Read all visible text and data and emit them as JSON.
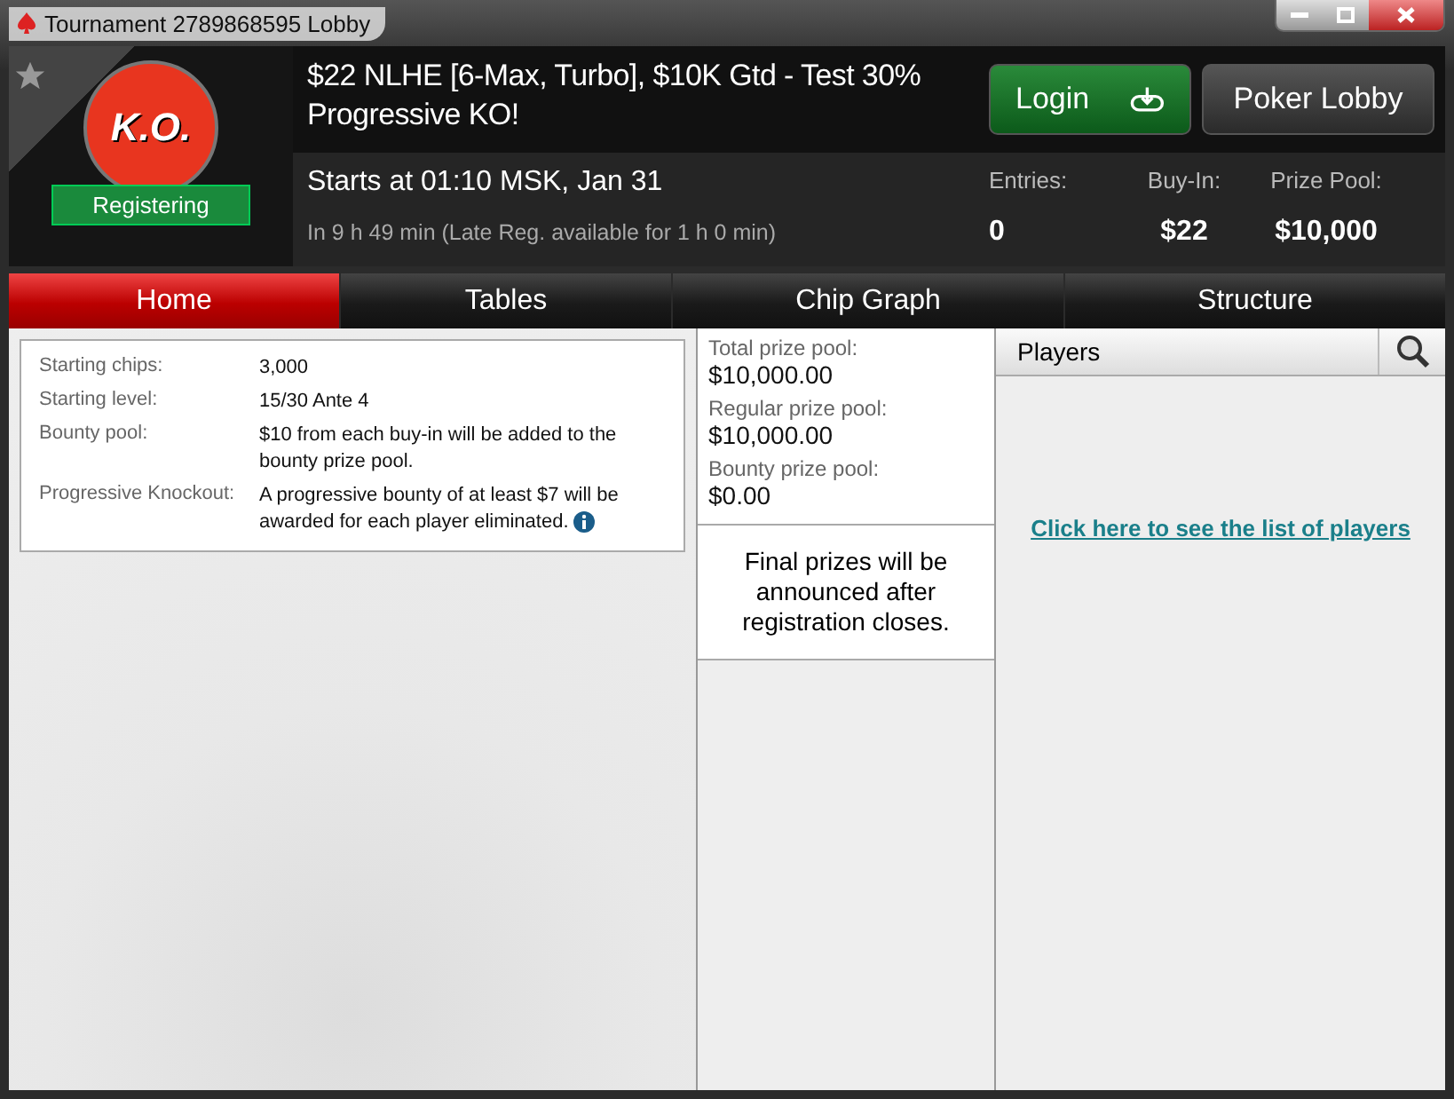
{
  "window": {
    "title": "Tournament 2789868595 Lobby"
  },
  "header": {
    "favorite": false,
    "badge_text": "K.O.",
    "status": "Registering",
    "title": "$22 NLHE [6-Max, Turbo], $10K Gtd - Test 30% Progressive KO!",
    "starts": "Starts at 01:10 MSK, Jan 31",
    "countdown": "In 9 h 49 min (Late Reg. available for 1 h 0 min)",
    "buttons": [
      {
        "label": "Login",
        "kind": "primary"
      },
      {
        "label": "Poker Lobby",
        "kind": "secondary"
      }
    ],
    "stats": [
      {
        "label": "Entries:",
        "value": "0"
      },
      {
        "label": "Buy-In:",
        "value": "$22"
      },
      {
        "label": "Prize Pool:",
        "value": "$10,000"
      }
    ]
  },
  "tabs": [
    {
      "label": "Home",
      "selected": true
    },
    {
      "label": "Tables",
      "selected": false
    },
    {
      "label": "Chip Graph",
      "selected": false
    },
    {
      "label": "Structure",
      "selected": false
    }
  ],
  "info": [
    {
      "label": "Starting chips:",
      "value": "3,000"
    },
    {
      "label": "Starting level:",
      "value": "15/30 Ante 4"
    },
    {
      "label": "Bounty pool:",
      "value": "$10 from each buy-in will be added to the bounty prize pool."
    },
    {
      "label": "Progressive Knockout:",
      "value": "A progressive bounty of at least $7 will be awarded for each player eliminated.",
      "info_icon": true
    }
  ],
  "prizes": [
    {
      "label": "Total prize pool:",
      "value": "$10,000.00"
    },
    {
      "label": "Regular prize pool:",
      "value": "$10,000.00"
    },
    {
      "label": "Bounty prize pool:",
      "value": "$0.00"
    }
  ],
  "prize_note": "Final prizes will be announced after registration closes.",
  "players": {
    "title": "Players",
    "link": "Click here to see the list of players"
  }
}
